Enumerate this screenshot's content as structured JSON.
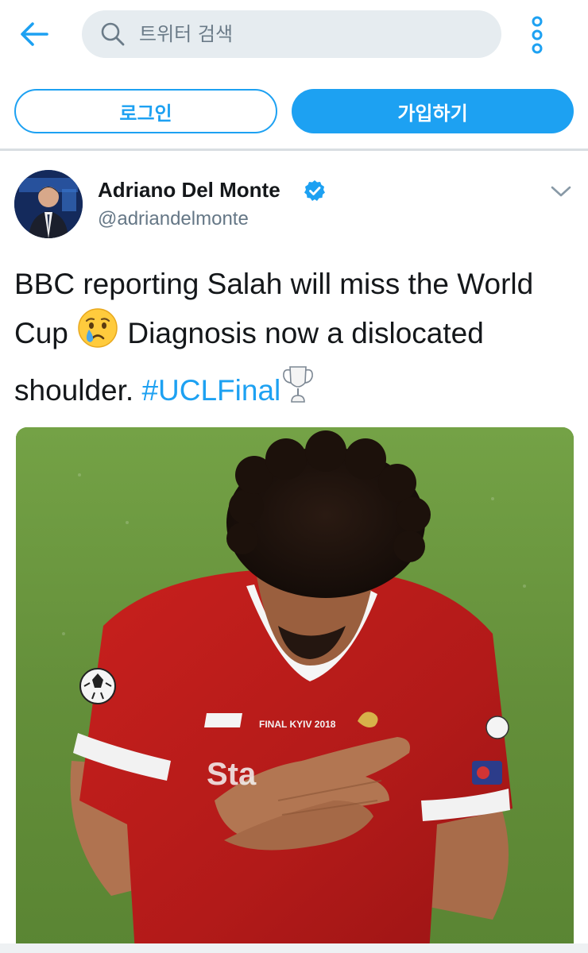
{
  "header": {
    "search_placeholder": "트위터 검색"
  },
  "auth": {
    "login_label": "로그인",
    "signup_label": "가입하기"
  },
  "tweet": {
    "author_name": "Adriano Del Monte",
    "author_handle": "@adriandelmonte",
    "text_part1": "BBC reporting Salah will miss the World Cup ",
    "text_part2": " Diagnosis now a dislocated shoulder. ",
    "hashtag": "#UCLFinal",
    "verified": true,
    "emoji_icon": "crying-face-icon",
    "trophy_icon": "trophy-icon"
  },
  "media": {
    "shirt_text": "FINAL KYIV 2018"
  },
  "colors": {
    "accent": "#1da1f2",
    "text": "#14171a",
    "secondary_text": "#657786",
    "search_bg": "#e6ecf0"
  }
}
